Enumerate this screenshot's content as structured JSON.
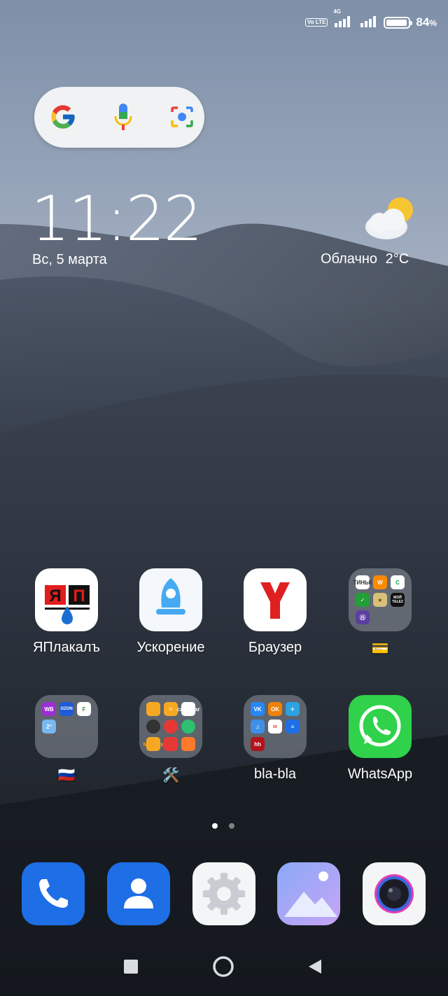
{
  "status_bar": {
    "volte": "Vo LTE",
    "network": "4G",
    "battery_percent": "84",
    "battery_level": 0.84,
    "percent_sign": "%"
  },
  "search_widget": {
    "icons": [
      "google-logo",
      "microphone-icon",
      "lens-camera-icon"
    ]
  },
  "clock_widget": {
    "time": "11:22",
    "date": "Вс, 5 марта"
  },
  "weather_widget": {
    "condition": "Облачно",
    "temperature": "2°C",
    "icon": "partly-cloudy-icon"
  },
  "home_apps": [
    {
      "label": "ЯПлакалъ",
      "icon": "yaplakal-logo"
    },
    {
      "label": "Ускорение",
      "icon": "rocket-icon"
    },
    {
      "label": "Браузер",
      "icon": "yandex-browser-icon"
    },
    {
      "label": "💳",
      "icon": "folder"
    },
    {
      "label": "🇷🇺",
      "icon": "folder"
    },
    {
      "label": "🛠️",
      "icon": "folder"
    },
    {
      "label": "bla-bla",
      "icon": "folder"
    },
    {
      "label": "WhatsApp",
      "icon": "whatsapp-icon"
    }
  ],
  "folder_contents": {
    "wallet_folder": [
      "ТИНЬК",
      "W",
      "С",
      "✓",
      "★",
      "МОЙ TELE2",
      "Ⓗ"
    ],
    "russia_folder": [
      "WB",
      "OZON",
      "F",
      "2°"
    ],
    "tools_folder": [
      "file",
      "=",
      "calendar",
      "clock",
      "rec",
      "radio",
      "toolbox",
      "phone",
      "mi"
    ],
    "blabla_folder": [
      "VK",
      "OK",
      "✈",
      "♫",
      "✉",
      "≡",
      "hh"
    ]
  },
  "page_indicator": {
    "pages": 2,
    "current": 1
  },
  "dock": [
    {
      "name": "phone",
      "icon": "phone-icon"
    },
    {
      "name": "contacts",
      "icon": "contacts-icon"
    },
    {
      "name": "settings",
      "icon": "gear-icon"
    },
    {
      "name": "gallery",
      "icon": "gallery-icon"
    },
    {
      "name": "camera",
      "icon": "camera-icon"
    }
  ],
  "nav_bar": {
    "buttons": [
      "recents",
      "home",
      "back"
    ]
  },
  "colors": {
    "whatsapp": "#2fd24a",
    "dock_blue": "#1e6ee6",
    "yandex_red": "#e02020",
    "google_blue": "#4285f4"
  }
}
